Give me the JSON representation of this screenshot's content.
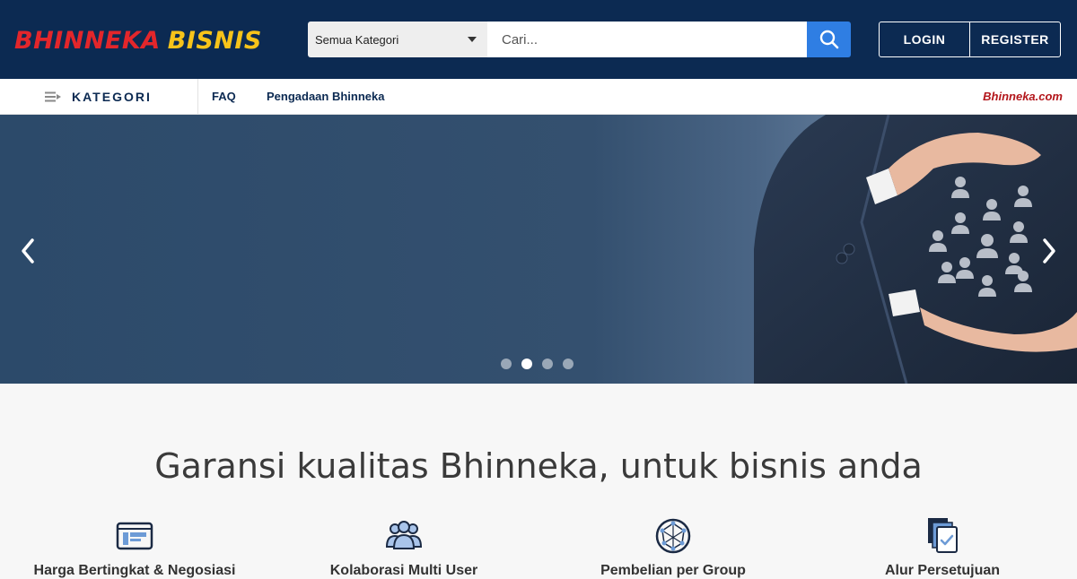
{
  "header": {
    "logo_primary": "BHINNEKA",
    "logo_secondary": "BISNIS",
    "search": {
      "category_label": "Semua Kategori",
      "placeholder": "Cari..."
    },
    "login_label": "LOGIN",
    "register_label": "REGISTER"
  },
  "nav": {
    "kategori_label": "KATEGORI",
    "links": [
      "FAQ",
      "Pengadaan Bhinneka"
    ],
    "brand_link": "Bhinneka.com"
  },
  "carousel": {
    "slide_count": 4,
    "active_index": 1
  },
  "section": {
    "title": "Garansi kualitas Bhinneka, untuk bisnis anda",
    "features": [
      {
        "label": "Harga Bertingkat & Negosiasi",
        "icon": "price-window-icon"
      },
      {
        "label": "Kolaborasi Multi User",
        "icon": "multi-user-icon"
      },
      {
        "label": "Pembelian per Group",
        "icon": "network-globe-icon"
      },
      {
        "label": "Alur Persetujuan",
        "icon": "approval-docs-icon"
      }
    ]
  },
  "colors": {
    "header_bg": "#0c2a52",
    "search_button": "#2f7ee3",
    "brand_red": "#e3262b",
    "brand_yellow": "#f7c31a"
  }
}
